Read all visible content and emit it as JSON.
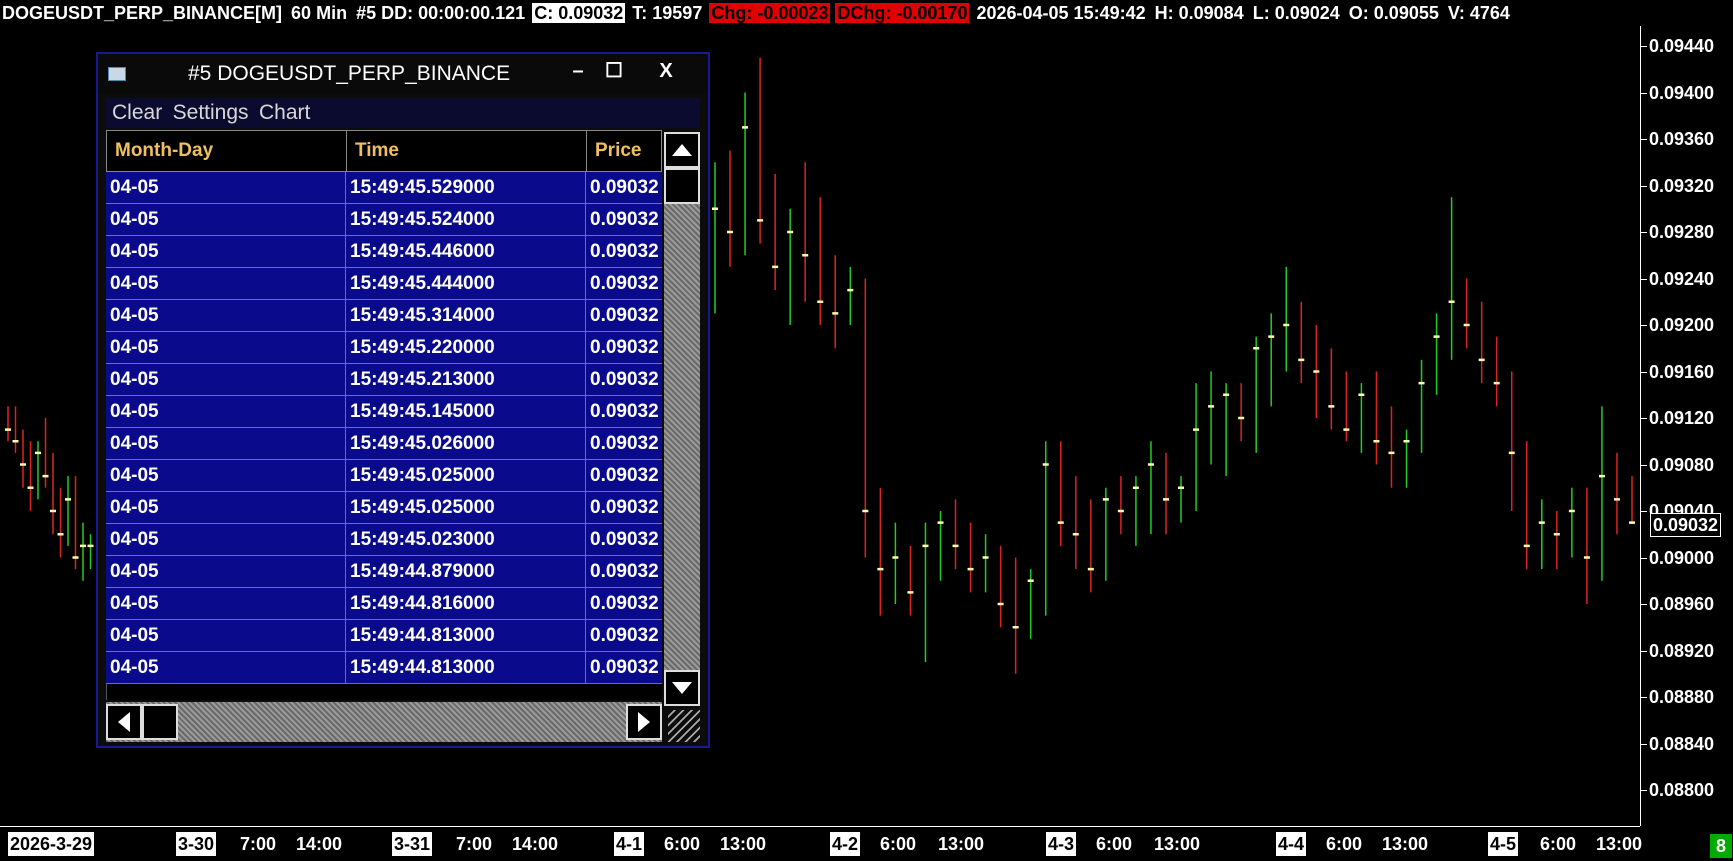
{
  "topbar": {
    "symbol": "DOGEUSDT_PERP_BINANCE[M]",
    "interval": "60 Min",
    "study": "#5 DD: 00:00:00.121",
    "close": "C: 0.09032",
    "trades": "T: 19597",
    "chg": "Chg: -0.00023",
    "dchg": "DChg: -0.00170",
    "datetime": "2026-04-05 15:49:42",
    "high": "H: 0.09084",
    "low": "L: 0.09024",
    "open": "O: 0.09055",
    "volume": "V: 4764"
  },
  "price_axis": {
    "labels": [
      "0.09440",
      "0.09400",
      "0.09360",
      "0.09320",
      "0.09280",
      "0.09240",
      "0.09200",
      "0.09160",
      "0.09120",
      "0.09080",
      "0.09040",
      "0.09000",
      "0.08960",
      "0.08920",
      "0.08880",
      "0.08840",
      "0.08800"
    ],
    "current": "0.09032"
  },
  "time_axis": {
    "labels": [
      {
        "t": "2026-3-29",
        "date": true
      },
      {
        "t": "3-30",
        "date": true
      },
      {
        "t": "7:00",
        "date": false
      },
      {
        "t": "14:00",
        "date": false
      },
      {
        "t": "3-31",
        "date": true
      },
      {
        "t": "7:00",
        "date": false
      },
      {
        "t": "14:00",
        "date": false
      },
      {
        "t": "4-1",
        "date": true
      },
      {
        "t": "6:00",
        "date": false
      },
      {
        "t": "13:00",
        "date": false
      },
      {
        "t": "4-2",
        "date": true
      },
      {
        "t": "6:00",
        "date": false
      },
      {
        "t": "13:00",
        "date": false
      },
      {
        "t": "4-3",
        "date": true
      },
      {
        "t": "6:00",
        "date": false
      },
      {
        "t": "13:00",
        "date": false
      },
      {
        "t": "4-4",
        "date": true
      },
      {
        "t": "6:00",
        "date": false
      },
      {
        "t": "13:00",
        "date": false
      },
      {
        "t": "4-5",
        "date": true
      },
      {
        "t": "6:00",
        "date": false
      },
      {
        "t": "13:00",
        "date": false
      }
    ]
  },
  "badge": "8",
  "window": {
    "title": "#5 DOGEUSDT_PERP_BINANCE",
    "minimize": "–",
    "maximize": "☐",
    "close": "X",
    "menu": [
      "Clear",
      "Settings",
      "Chart"
    ],
    "columns": [
      "Month-Day",
      "Time",
      "Price"
    ],
    "rows": [
      [
        "04-05",
        "15:49:45.529000",
        "0.09032"
      ],
      [
        "04-05",
        "15:49:45.524000",
        "0.09032"
      ],
      [
        "04-05",
        "15:49:45.446000",
        "0.09032"
      ],
      [
        "04-05",
        "15:49:45.444000",
        "0.09032"
      ],
      [
        "04-05",
        "15:49:45.314000",
        "0.09032"
      ],
      [
        "04-05",
        "15:49:45.220000",
        "0.09032"
      ],
      [
        "04-05",
        "15:49:45.213000",
        "0.09032"
      ],
      [
        "04-05",
        "15:49:45.145000",
        "0.09032"
      ],
      [
        "04-05",
        "15:49:45.026000",
        "0.09032"
      ],
      [
        "04-05",
        "15:49:45.025000",
        "0.09032"
      ],
      [
        "04-05",
        "15:49:45.025000",
        "0.09032"
      ],
      [
        "04-05",
        "15:49:45.023000",
        "0.09032"
      ],
      [
        "04-05",
        "15:49:44.879000",
        "0.09032"
      ],
      [
        "04-05",
        "15:49:44.816000",
        "0.09032"
      ],
      [
        "04-05",
        "15:49:44.813000",
        "0.09032"
      ],
      [
        "04-05",
        "15:49:44.813000",
        "0.09032"
      ]
    ]
  },
  "colors": {
    "up": "#22cc22",
    "down": "#dd2222",
    "tick": "#ffffaa",
    "window_border": "#1a1a90",
    "row_bg": "#0a0a8c",
    "header_text": "#f0c060"
  },
  "chart_data": {
    "type": "ohlc",
    "ylim": [
      0.0878,
      0.0946
    ],
    "bars": [
      [
        0.0912,
        0.0913,
        0.091,
        0.0911
      ],
      [
        0.0911,
        0.0913,
        0.0909,
        0.091
      ],
      [
        0.091,
        0.0911,
        0.0906,
        0.0908
      ],
      [
        0.0908,
        0.091,
        0.0904,
        0.0906
      ],
      [
        0.0906,
        0.091,
        0.0905,
        0.0909
      ],
      [
        0.0909,
        0.0912,
        0.0906,
        0.0907
      ],
      [
        0.0907,
        0.0909,
        0.0902,
        0.0904
      ],
      [
        0.0904,
        0.0906,
        0.09,
        0.0902
      ],
      [
        0.0902,
        0.0907,
        0.0901,
        0.0905
      ],
      [
        0.0905,
        0.0907,
        0.0899,
        0.09
      ],
      [
        0.09,
        0.0903,
        0.0898,
        0.0901
      ],
      [
        0.0901,
        0.0902,
        0.0899,
        0.0901
      ],
      [
        0.0923,
        0.0934,
        0.0921,
        0.093
      ],
      [
        0.093,
        0.0935,
        0.0925,
        0.0928
      ],
      [
        0.0928,
        0.094,
        0.0926,
        0.0937
      ],
      [
        0.0937,
        0.0943,
        0.0927,
        0.0929
      ],
      [
        0.0929,
        0.0933,
        0.0923,
        0.0925
      ],
      [
        0.0925,
        0.093,
        0.092,
        0.0928
      ],
      [
        0.0928,
        0.0934,
        0.0922,
        0.0926
      ],
      [
        0.0926,
        0.0931,
        0.092,
        0.0922
      ],
      [
        0.0922,
        0.0926,
        0.0918,
        0.0921
      ],
      [
        0.0921,
        0.0925,
        0.092,
        0.0923
      ],
      [
        0.0923,
        0.0924,
        0.09,
        0.0904
      ],
      [
        0.0904,
        0.0906,
        0.0895,
        0.0899
      ],
      [
        0.0899,
        0.0903,
        0.0896,
        0.09
      ],
      [
        0.09,
        0.0901,
        0.0895,
        0.0897
      ],
      [
        0.0897,
        0.0903,
        0.0891,
        0.0901
      ],
      [
        0.0901,
        0.0904,
        0.0898,
        0.0903
      ],
      [
        0.0903,
        0.0905,
        0.0899,
        0.0901
      ],
      [
        0.0901,
        0.0903,
        0.0897,
        0.0899
      ],
      [
        0.0899,
        0.0902,
        0.0897,
        0.09
      ],
      [
        0.09,
        0.0901,
        0.0894,
        0.0896
      ],
      [
        0.0896,
        0.09,
        0.089,
        0.0894
      ],
      [
        0.0894,
        0.0899,
        0.0893,
        0.0898
      ],
      [
        0.0898,
        0.091,
        0.0895,
        0.0908
      ],
      [
        0.0908,
        0.091,
        0.0901,
        0.0903
      ],
      [
        0.0903,
        0.0907,
        0.0899,
        0.0902
      ],
      [
        0.0902,
        0.0905,
        0.0897,
        0.0899
      ],
      [
        0.0899,
        0.0906,
        0.0898,
        0.0905
      ],
      [
        0.0905,
        0.0907,
        0.0902,
        0.0904
      ],
      [
        0.0904,
        0.0907,
        0.0901,
        0.0906
      ],
      [
        0.0906,
        0.091,
        0.0902,
        0.0908
      ],
      [
        0.0908,
        0.0909,
        0.0902,
        0.0905
      ],
      [
        0.0905,
        0.0907,
        0.0903,
        0.0906
      ],
      [
        0.0906,
        0.0915,
        0.0904,
        0.0911
      ],
      [
        0.0911,
        0.0916,
        0.0908,
        0.0913
      ],
      [
        0.0913,
        0.0915,
        0.0907,
        0.0914
      ],
      [
        0.0914,
        0.0915,
        0.091,
        0.0912
      ],
      [
        0.0912,
        0.0919,
        0.0909,
        0.0918
      ],
      [
        0.0918,
        0.0921,
        0.0913,
        0.0919
      ],
      [
        0.0919,
        0.0925,
        0.0916,
        0.092
      ],
      [
        0.092,
        0.0922,
        0.0915,
        0.0917
      ],
      [
        0.0917,
        0.092,
        0.0912,
        0.0916
      ],
      [
        0.0916,
        0.0918,
        0.0911,
        0.0913
      ],
      [
        0.0913,
        0.0916,
        0.091,
        0.0911
      ],
      [
        0.0911,
        0.0915,
        0.0909,
        0.0914
      ],
      [
        0.0914,
        0.0916,
        0.0908,
        0.091
      ],
      [
        0.091,
        0.0913,
        0.0906,
        0.0909
      ],
      [
        0.0909,
        0.0911,
        0.0906,
        0.091
      ],
      [
        0.091,
        0.0917,
        0.0909,
        0.0915
      ],
      [
        0.0915,
        0.0921,
        0.0914,
        0.0919
      ],
      [
        0.0919,
        0.0931,
        0.0917,
        0.0922
      ],
      [
        0.0922,
        0.0924,
        0.0918,
        0.092
      ],
      [
        0.092,
        0.0922,
        0.0915,
        0.0917
      ],
      [
        0.0917,
        0.0919,
        0.0913,
        0.0915
      ],
      [
        0.0915,
        0.0916,
        0.0904,
        0.0909
      ],
      [
        0.0909,
        0.091,
        0.0899,
        0.0901
      ],
      [
        0.0901,
        0.0905,
        0.0899,
        0.0903
      ],
      [
        0.0903,
        0.0904,
        0.0899,
        0.0902
      ],
      [
        0.0902,
        0.0906,
        0.09,
        0.0904
      ],
      [
        0.0904,
        0.0906,
        0.0896,
        0.09
      ],
      [
        0.09,
        0.0913,
        0.0898,
        0.0907
      ],
      [
        0.0907,
        0.0909,
        0.0902,
        0.0905
      ],
      [
        0.0905,
        0.0907,
        0.0903,
        0.0903
      ]
    ]
  }
}
